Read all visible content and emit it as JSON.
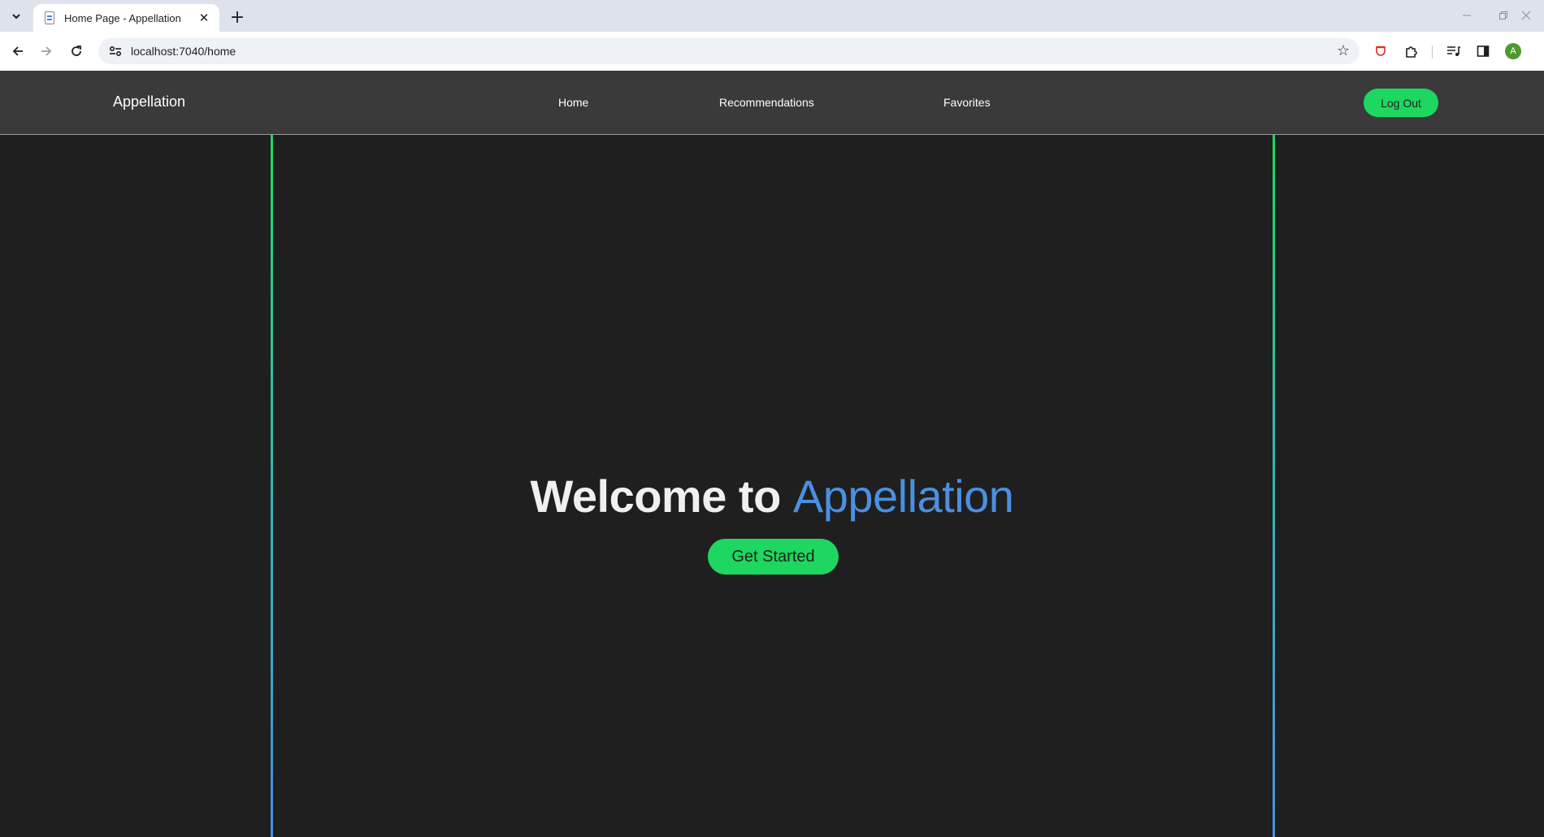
{
  "browser": {
    "tab": {
      "title": "Home Page - Appellation"
    },
    "address_bar": {
      "url": "localhost:7040/home"
    },
    "profile_initial": "A"
  },
  "site": {
    "brand": "Appellation",
    "nav": {
      "home": "Home",
      "recommendations": "Recommendations",
      "favorites": "Favorites"
    },
    "logout_label": "Log Out"
  },
  "hero": {
    "title_prefix": "Welcome to",
    "title_accent": "Appellation",
    "cta_label": "Get Started"
  },
  "colors": {
    "background": "#1f1f1f",
    "navbar": "#3a3a3a",
    "accent_green": "#1ed760",
    "accent_blue": "#4a90e2"
  },
  "icons": {
    "tab_search": "chevron-down-icon",
    "favicon": "page-icon",
    "close": "close-icon",
    "new_tab": "plus-icon",
    "back": "back-arrow-icon",
    "forward": "forward-arrow-icon",
    "reload": "reload-icon",
    "site_info": "tune-icon",
    "bookmark": "star-icon",
    "extensions": "puzzle-icon",
    "side_panel": "side-panel-icon",
    "menu": "more-vert-icon"
  }
}
